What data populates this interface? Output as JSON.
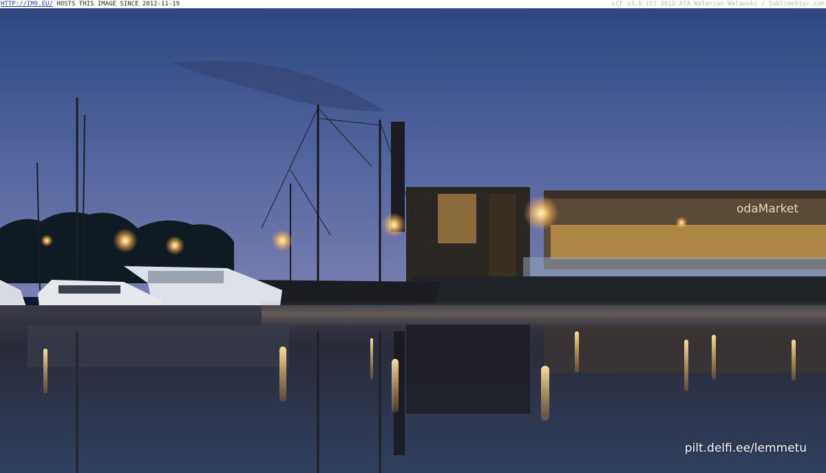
{
  "header": {
    "link": "HTTP://IM9.EU/",
    "hosts_text": " HOSTS THIS IMAGE SINCE 2012-11-19",
    "credit": "LCF v3.6 (C) 2012 ATA Walerian Walawski / SublimeStar.com"
  },
  "photo": {
    "sign_text": "odaMarket",
    "watermark": "pilt.delfi.ee/lemmetu"
  },
  "colors": {
    "sky_top": "#3b5590",
    "sky_horizon": "#6d7cb0",
    "water": "#2c3752",
    "light_glow": "#ffd57a"
  }
}
